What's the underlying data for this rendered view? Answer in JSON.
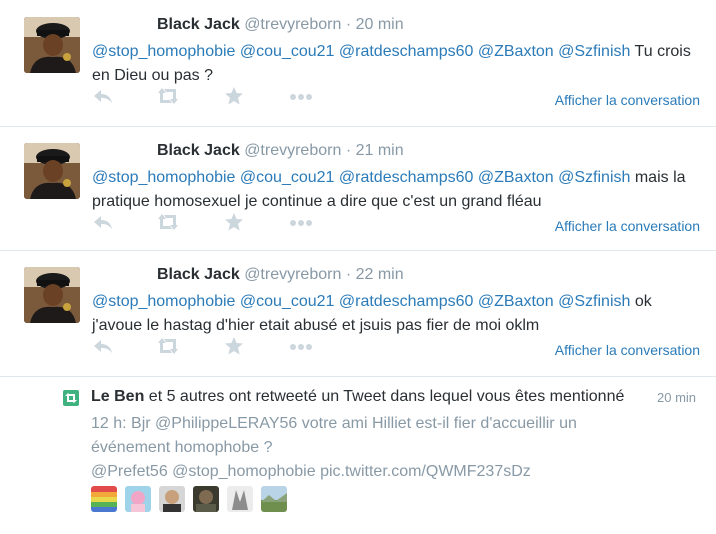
{
  "tweets": [
    {
      "name": "Black Jack",
      "handle": "@trevyreborn",
      "time": "· 20 min",
      "mentions": "@stop_homophobie @cou_cou21 @ratdeschamps60 @ZBaxton @Szfinish",
      "text": " Tu crois en Dieu ou pas ?",
      "conversation": "Afficher la conversation"
    },
    {
      "name": "Black Jack",
      "handle": "@trevyreborn",
      "time": "· 21 min",
      "mentions": "@stop_homophobie @cou_cou21 @ratdeschamps60 @ZBaxton @Szfinish",
      "text": " mais la pratique homosexuel je continue a dire que c'est un grand fléau",
      "conversation": "Afficher la conversation"
    },
    {
      "name": "Black Jack",
      "handle": "@trevyreborn",
      "time": "· 22 min",
      "mentions": "@stop_homophobie @cou_cou21 @ratdeschamps60 @ZBaxton @Szfinish",
      "text": " ok j'avoue le hastag d'hier etait abusé et jsuis pas fier de moi oklm",
      "conversation": "Afficher la conversation"
    }
  ],
  "notification": {
    "actor": "Le Ben",
    "text": " et 5 autres ont retweeté un Tweet dans lequel vous êtes mentionné",
    "time": "20 min",
    "line1_prefix": "12 h: Bjr ",
    "line1_mention": "@PhilippeLERAY56",
    "line1_rest": " votre ami Hilliet est-il fier d'accueillir un événement homophobe ?",
    "line2": "@Prefet56 @stop_homophobie pic.twitter.com/QWMF237sDz"
  },
  "colors": {
    "link": "#2b7bb9",
    "muted": "#8899a6",
    "text": "#292f33",
    "retweet_green": "#3fb27f",
    "icon": "#ccd6dd"
  },
  "icons": [
    "reply-icon",
    "retweet-icon",
    "favorite-star-icon",
    "more-dots-icon"
  ]
}
